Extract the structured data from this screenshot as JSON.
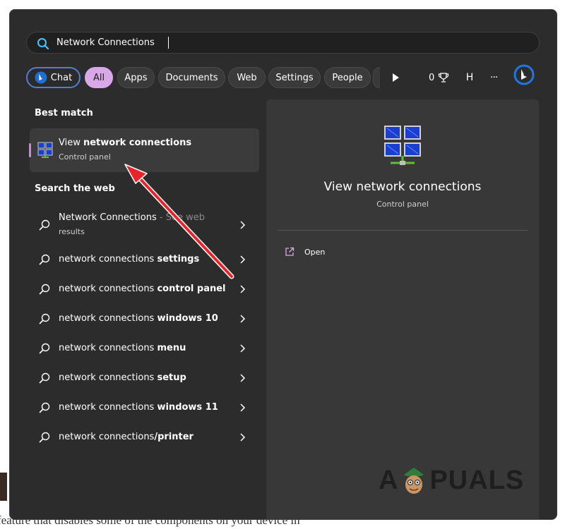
{
  "search": {
    "query": "Network Connections"
  },
  "filters": [
    {
      "label": "Chat",
      "selected": false
    },
    {
      "label": "All",
      "selected": true
    },
    {
      "label": "Apps",
      "selected": false
    },
    {
      "label": "Documents",
      "selected": false
    },
    {
      "label": "Web",
      "selected": false
    },
    {
      "label": "Settings",
      "selected": false
    },
    {
      "label": "People",
      "selected": false
    }
  ],
  "toolbar": {
    "points": "0",
    "avatar_initial": "H",
    "more_label": "···"
  },
  "best_match": {
    "heading": "Best match",
    "title_plain": "View ",
    "title_bold": "network connections",
    "subtitle": "Control panel"
  },
  "web": {
    "heading": "Search the web",
    "items": [
      {
        "plain": "Network Connections",
        "bold": "",
        "suffix": " - See web",
        "sub": "results"
      },
      {
        "plain": "network connections ",
        "bold": "settings"
      },
      {
        "plain": "network connections ",
        "bold": "control panel"
      },
      {
        "plain": "network connections ",
        "bold": "windows 10"
      },
      {
        "plain": "network connections ",
        "bold": "menu"
      },
      {
        "plain": "network connections ",
        "bold": "setup"
      },
      {
        "plain": "network connections ",
        "bold": "windows 11"
      },
      {
        "plain": "network connections",
        "bold": "/printer"
      }
    ]
  },
  "detail": {
    "title": "View network connections",
    "subtitle": "Control panel",
    "open_label": "Open"
  },
  "watermark": {
    "left": "A",
    "right": "PUALS"
  },
  "background": {
    "text": "feature that disables some of the components on your device in"
  },
  "colors": {
    "accent_pill": "#d9a8e8",
    "chat_border": "#4d7fd8",
    "arrow": "#e8232a",
    "panel_bg": "#2c2c2c",
    "detail_bg": "#383838"
  },
  "icons": {
    "search": "search-icon",
    "bing": "bing-icon",
    "play": "play-icon",
    "trophy": "trophy-icon",
    "network": "network-connections-icon",
    "open": "open-external-icon",
    "chevron": "chevron-right-icon"
  }
}
